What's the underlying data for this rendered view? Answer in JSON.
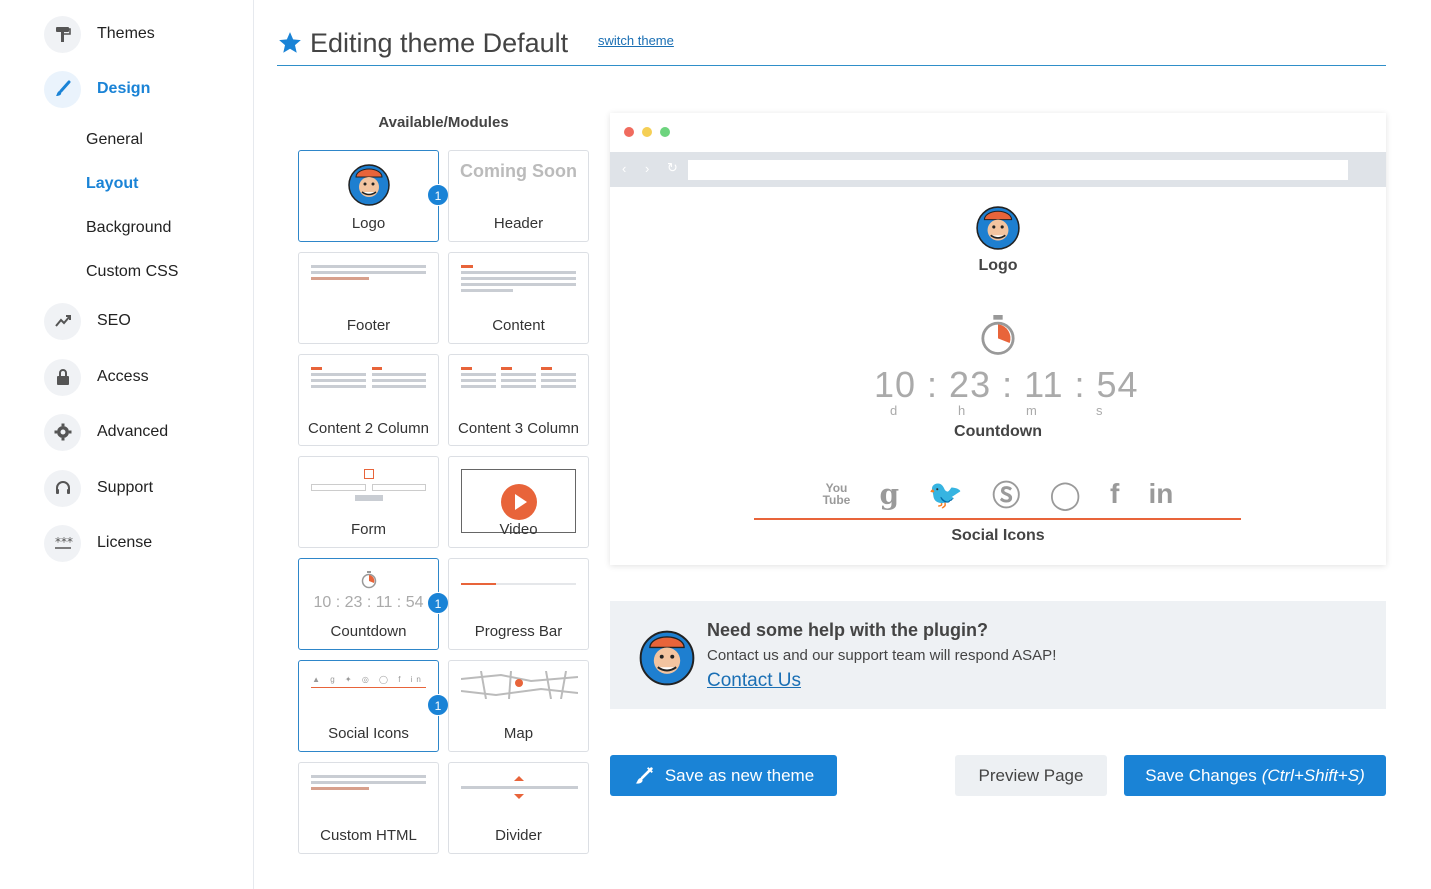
{
  "sidebar": {
    "items": [
      {
        "label": "Themes",
        "icon": "paint-roller-icon"
      },
      {
        "label": "Design",
        "icon": "brush-icon"
      },
      {
        "label": "SEO",
        "icon": "chart-line-icon"
      },
      {
        "label": "Access",
        "icon": "lock-icon"
      },
      {
        "label": "Advanced",
        "icon": "gear-icon"
      },
      {
        "label": "Support",
        "icon": "headset-icon"
      },
      {
        "label": "License",
        "icon": "password-dots-icon"
      }
    ],
    "design_sub": [
      "General",
      "Layout",
      "Background",
      "Custom CSS"
    ]
  },
  "header": {
    "title": "Editing theme Default",
    "switch_link": "switch theme"
  },
  "modules": {
    "title": "Available/Modules",
    "items": [
      {
        "label": "Logo",
        "badge": "1"
      },
      {
        "label": "Header",
        "thumb_text": "Coming Soon"
      },
      {
        "label": "Footer"
      },
      {
        "label": "Content"
      },
      {
        "label": "Content 2 Column"
      },
      {
        "label": "Content 3 Column"
      },
      {
        "label": "Form"
      },
      {
        "label": "Video"
      },
      {
        "label": "Countdown",
        "badge": "1",
        "thumb_text": "10 : 23 : 11 : 54"
      },
      {
        "label": "Progress Bar"
      },
      {
        "label": "Social Icons",
        "badge": "1"
      },
      {
        "label": "Map"
      },
      {
        "label": "Custom HTML"
      },
      {
        "label": "Divider"
      }
    ]
  },
  "preview": {
    "logo_label": "Logo",
    "countdown_digits": "10 : 23 : 11 : 54",
    "countdown_units": [
      "d",
      "h",
      "m",
      "s"
    ],
    "countdown_label": "Countdown",
    "social_label": "Social Icons",
    "social_icons": [
      "youtube-icon",
      "google-icon",
      "twitter-icon",
      "skype-icon",
      "whatsapp-icon",
      "facebook-icon",
      "linkedin-icon"
    ]
  },
  "help": {
    "title": "Need some help with the plugin?",
    "text": "Contact us and our support team will respond ASAP!",
    "link": "Contact Us"
  },
  "buttons": {
    "save_new": "Save as new theme",
    "preview": "Preview Page",
    "save": "Save Changes",
    "save_shortcut": "(Ctrl+Shift+S)"
  },
  "colors": {
    "accent": "#1a83d6",
    "orange": "#e8643a"
  }
}
